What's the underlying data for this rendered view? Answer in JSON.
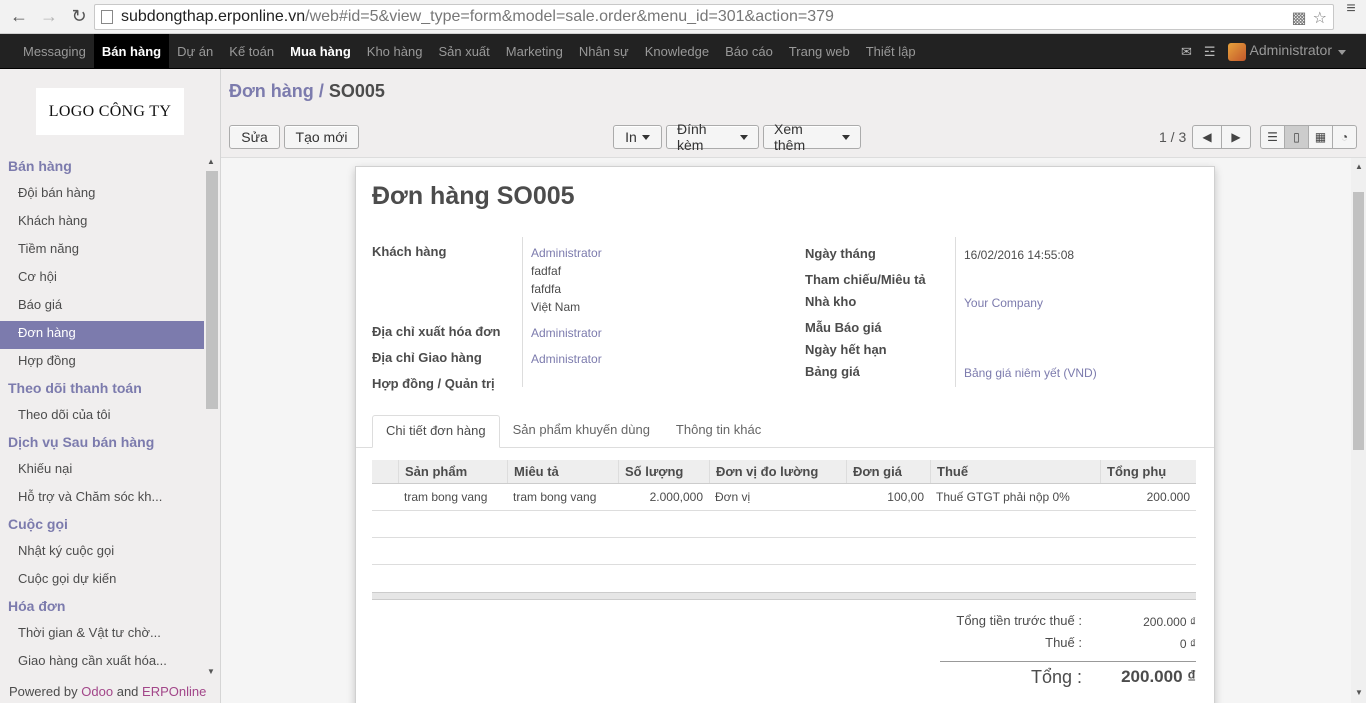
{
  "browser": {
    "url_host": "subdongthap.erponline.vn",
    "url_path": "/web#id=5&view_type=form&model=sale.order&menu_id=301&action=379"
  },
  "topbar": {
    "items": [
      {
        "label": "Messaging"
      },
      {
        "label": "Bán hàng"
      },
      {
        "label": "Dự án"
      },
      {
        "label": "Kế toán"
      },
      {
        "label": "Mua hàng"
      },
      {
        "label": "Kho hàng"
      },
      {
        "label": "Sản xuất"
      },
      {
        "label": "Marketing"
      },
      {
        "label": "Nhân sự"
      },
      {
        "label": "Knowledge"
      },
      {
        "label": "Báo cáo"
      },
      {
        "label": "Trang web"
      },
      {
        "label": "Thiết lập"
      }
    ],
    "user": "Administrator"
  },
  "sidebar": {
    "logo": "LOGO CÔNG TY",
    "sections": [
      {
        "title": "Bán hàng",
        "items": [
          "Đội bán hàng",
          "Khách hàng",
          "Tiềm năng",
          "Cơ hội",
          "Báo giá",
          "Đơn hàng",
          "Hợp đồng"
        ]
      },
      {
        "title": "Theo dõi thanh toán",
        "items": [
          "Theo dõi của tôi"
        ]
      },
      {
        "title": "Dịch vụ Sau bán hàng",
        "items": [
          "Khiếu nại",
          "Hỗ trợ và Chăm sóc kh..."
        ]
      },
      {
        "title": "Cuộc gọi",
        "items": [
          "Nhật ký cuộc gọi",
          "Cuộc gọi dự kiến"
        ]
      },
      {
        "title": "Hóa đơn",
        "items": [
          "Thời gian & Vật tư chờ...",
          "Giao hàng cần xuất hóa..."
        ]
      }
    ],
    "powered_prefix": "Powered by",
    "powered_odoo": "Odoo",
    "powered_and": "and",
    "powered_erp": "ERPOnline"
  },
  "header": {
    "breadcrumb_root": "Đơn hàng",
    "breadcrumb_sep": "/",
    "breadcrumb_current": "SO005",
    "edit_label": "Sửa",
    "create_label": "Tạo mới",
    "print_label": "In",
    "attach_label": "Đính kèm",
    "more_label": "Xem thêm",
    "pager": "1 / 3"
  },
  "form": {
    "title": "Đơn hàng SO005",
    "customer_label": "Khách hàng",
    "customer_name": "Administrator",
    "customer_addr1": "fadfaf",
    "customer_addr2": "fafdfa",
    "customer_country": "Việt Nam",
    "invoice_addr_label": "Địa chỉ xuất hóa đơn",
    "invoice_addr": "Administrator",
    "shipping_addr_label": "Địa chỉ Giao hàng",
    "shipping_addr": "Administrator",
    "contract_label": "Hợp đồng / Quản trị",
    "date_label": "Ngày tháng",
    "date_value": "16/02/2016 14:55:08",
    "reference_label": "Tham chiếu/Miêu tả",
    "warehouse_label": "Nhà kho",
    "warehouse_value": "Your Company",
    "template_label": "Mẫu Báo giá",
    "expiry_label": "Ngày hết hạn",
    "pricelist_label": "Bảng giá",
    "pricelist_value": "Bảng giá niêm yết (VND)"
  },
  "tabs": [
    "Chi tiết đơn hàng",
    "Sản phẩm khuyến dùng",
    "Thông tin khác"
  ],
  "order_lines": {
    "columns": [
      "Sản phẩm",
      "Miêu tả",
      "Số lượng",
      "Đơn vị đo lường",
      "Đơn giá",
      "Thuế",
      "Tổng phụ"
    ],
    "rows": [
      [
        "tram bong vang",
        "tram bong vang",
        "2.000,000",
        "Đơn vị",
        "100,00",
        "Thuế GTGT phải nộp 0%",
        "200.000"
      ]
    ]
  },
  "totals": {
    "untaxed_label": "Tổng tiền trước thuế :",
    "untaxed_value": "200.000 ₫",
    "tax_label": "Thuế :",
    "tax_value": "0 ₫",
    "total_label": "Tổng :",
    "total_value": "200.000 ₫"
  }
}
